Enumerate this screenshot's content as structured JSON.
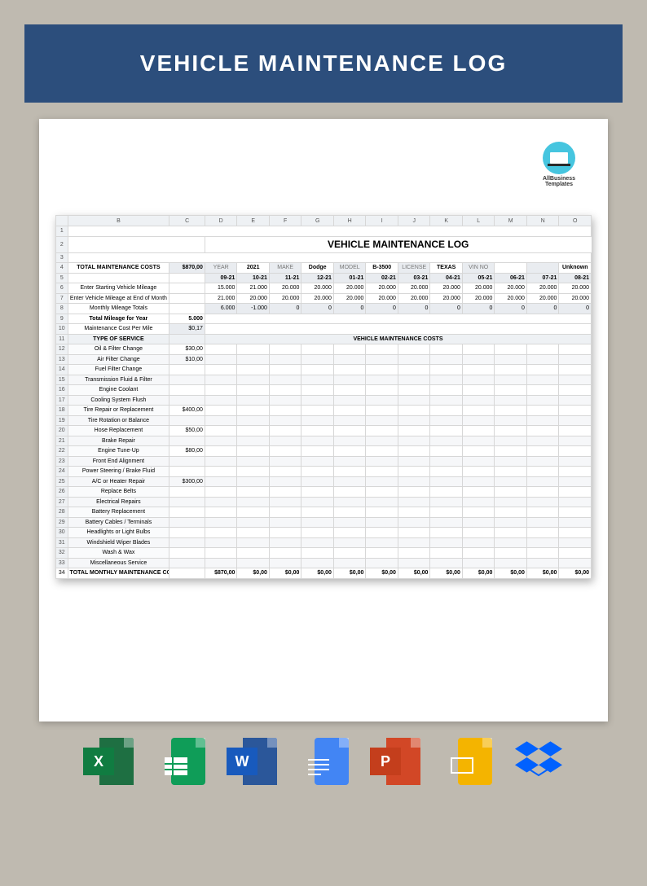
{
  "header": {
    "title": "VEHICLE MAINTENANCE LOG"
  },
  "logo": {
    "line1": "AllBusiness",
    "line2": "Templates"
  },
  "sheet": {
    "title": "VEHICLE MAINTENANCE LOG",
    "columns": [
      "",
      "B",
      "C",
      "D",
      "E",
      "F",
      "G",
      "H",
      "I",
      "J",
      "K",
      "L",
      "M",
      "N",
      "O"
    ],
    "row_numbers": [
      "1",
      "2",
      "3",
      "4",
      "5",
      "6",
      "7",
      "8",
      "9",
      "10",
      "11",
      "12",
      "13",
      "14",
      "15",
      "16",
      "17",
      "18",
      "19",
      "20",
      "21",
      "22",
      "23",
      "24",
      "25",
      "26",
      "27",
      "28",
      "29",
      "30",
      "31",
      "32",
      "33",
      "34"
    ],
    "total_costs_label": "TOTAL MAINTENANCE COSTS",
    "total_costs_value": "$870,00",
    "info_pairs": [
      {
        "k": "YEAR",
        "v": "2021"
      },
      {
        "k": "MAKE",
        "v": "Dodge"
      },
      {
        "k": "MODEL",
        "v": "B-3500"
      },
      {
        "k": "LICENSE",
        "v": "TEXAS"
      },
      {
        "k": "VIN NO",
        "v": ""
      },
      {
        "k": "",
        "v": "Unknown"
      }
    ],
    "months": [
      "09-21",
      "10-21",
      "11-21",
      "12-21",
      "01-21",
      "02-21",
      "03-21",
      "04-21",
      "05-21",
      "06-21",
      "07-21",
      "08-21"
    ],
    "rows_mileage": [
      {
        "label": "Enter Starting Vehicle Mileage",
        "vals": [
          "15.000",
          "21.000",
          "20.000",
          "20.000",
          "20.000",
          "20.000",
          "20.000",
          "20.000",
          "20.000",
          "20.000",
          "20.000",
          "20.000"
        ]
      },
      {
        "label": "Enter Vehicle Mileage at End of Month",
        "vals": [
          "21.000",
          "20.000",
          "20.000",
          "20.000",
          "20.000",
          "20.000",
          "20.000",
          "20.000",
          "20.000",
          "20.000",
          "20.000",
          "20.000"
        ]
      },
      {
        "label": "Monthly Mileage Totals",
        "vals": [
          "6.000",
          "-1.000",
          "0",
          "0",
          "0",
          "0",
          "0",
          "0",
          "0",
          "0",
          "0",
          "0"
        ],
        "grey": true
      }
    ],
    "total_mileage_label": "Total Mileage for Year",
    "total_mileage_value": "5.000",
    "cost_per_mile_label": "Maintenance Cost Per Mile",
    "cost_per_mile_value": "$0,17",
    "section_type": "TYPE OF SERVICE",
    "section_costs": "VEHICLE MAINTENANCE COSTS",
    "services": [
      {
        "n": "Oil & Filter Change",
        "c": "$30,00"
      },
      {
        "n": "Air Filter Change",
        "c": "$10,00"
      },
      {
        "n": "Fuel Filter Change",
        "c": ""
      },
      {
        "n": "Transmission Fluid & Filter",
        "c": ""
      },
      {
        "n": "Engine Coolant",
        "c": ""
      },
      {
        "n": "Cooling System Flush",
        "c": ""
      },
      {
        "n": "Tire Repair or Replacement",
        "c": "$400,00"
      },
      {
        "n": "Tire Rotation or Balance",
        "c": ""
      },
      {
        "n": "Hose Replacement",
        "c": "$50,00"
      },
      {
        "n": "Brake Repair",
        "c": ""
      },
      {
        "n": "Engine Tune-Up",
        "c": "$80,00"
      },
      {
        "n": "Front End Alignment",
        "c": ""
      },
      {
        "n": "Power Steering / Brake Fluid",
        "c": ""
      },
      {
        "n": "A/C or Heater Repair",
        "c": "$300,00"
      },
      {
        "n": "Replace Belts",
        "c": ""
      },
      {
        "n": "Electrical Repairs",
        "c": ""
      },
      {
        "n": "Battery Replacement",
        "c": ""
      },
      {
        "n": "Battery Cables / Terminals",
        "c": ""
      },
      {
        "n": "Headlights or Light Bulbs",
        "c": ""
      },
      {
        "n": "Windshield Wiper Blades",
        "c": ""
      },
      {
        "n": "Wash & Wax",
        "c": ""
      },
      {
        "n": "Miscellaneous Service",
        "c": ""
      }
    ],
    "footer_label": "TOTAL MONTHLY MAINTENANCE COSTS",
    "footer_vals": [
      "$870,00",
      "$0,00",
      "$0,00",
      "$0,00",
      "$0,00",
      "$0,00",
      "$0,00",
      "$0,00",
      "$0,00",
      "$0,00",
      "$0,00",
      "$0,00"
    ]
  },
  "icons": {
    "excel": "X",
    "word": "W",
    "ppt": "P"
  }
}
